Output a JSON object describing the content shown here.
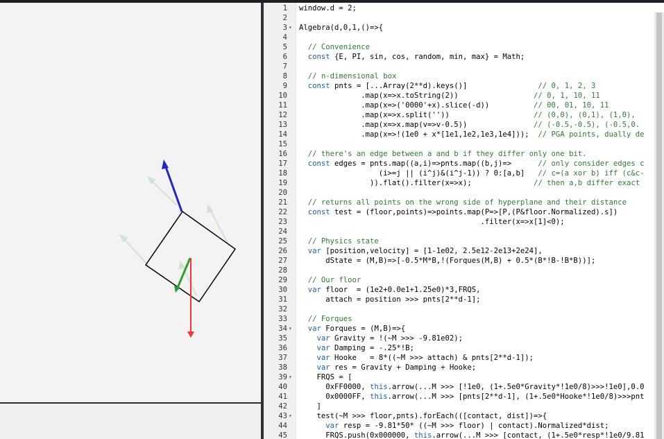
{
  "editor": {
    "lines": [
      {
        "n": "1",
        "fold": "",
        "code": "window.d = 2;"
      },
      {
        "n": "2",
        "fold": "",
        "code": ""
      },
      {
        "n": "3",
        "fold": "▾",
        "code": "Algebra(d,0,1,()=>{"
      },
      {
        "n": "4",
        "fold": "",
        "code": ""
      },
      {
        "n": "5",
        "fold": "",
        "code": "  // Convenience"
      },
      {
        "n": "6",
        "fold": "",
        "code": "  const {E, PI, sin, cos, random, min, max} = Math;"
      },
      {
        "n": "7",
        "fold": "",
        "code": ""
      },
      {
        "n": "8",
        "fold": "",
        "code": "  // n-dimensional box"
      },
      {
        "n": "9",
        "fold": "",
        "code": "  const pnts = [...Array(2**d).keys()]                // 0, 1, 2, 3"
      },
      {
        "n": "10",
        "fold": "",
        "code": "              .map(x=>x.toString(2))                 // 0, 1, 10, 11"
      },
      {
        "n": "11",
        "fold": "",
        "code": "              .map(x=>('0000'+x).slice(-d))          // 00, 01, 10, 11"
      },
      {
        "n": "12",
        "fold": "",
        "code": "              .map(x=>x.split(''))                   // (0,0), (0,1), (1,0),"
      },
      {
        "n": "13",
        "fold": "",
        "code": "              .map(x=>x.map(v=>v-0.5))               // (-0.5,-0.5), (-0.5,0."
      },
      {
        "n": "14",
        "fold": "",
        "code": "              .map(x=>!(1e0 + x*[1e1,1e2,1e3,1e4]));  // PGA points, dually de"
      },
      {
        "n": "15",
        "fold": "",
        "code": ""
      },
      {
        "n": "16",
        "fold": "",
        "code": "  // there's an edge between a and b if they differ only one bit."
      },
      {
        "n": "17",
        "fold": "",
        "code": "  const edges = pnts.map((a,i)=>pnts.map((b,j)=>      // only consider edges c"
      },
      {
        "n": "18",
        "fold": "",
        "code": "                  (i>=j || (i^j)&(i^j-1)) ? 0:[a,b]   // c=(a xor b) iff (c&c-"
      },
      {
        "n": "19",
        "fold": "",
        "code": "                )).flat().filter(x=>x);              // then a,b differ exact"
      },
      {
        "n": "20",
        "fold": "",
        "code": ""
      },
      {
        "n": "21",
        "fold": "",
        "code": "  // returns all points on the wrong side of hyperplane and their distance"
      },
      {
        "n": "22",
        "fold": "",
        "code": "  const test = (floor,points)=>points.map(P=>[P,(P&floor.Normalized).s])"
      },
      {
        "n": "23",
        "fold": "",
        "code": "                                         .filter(x=>x[1]<0);"
      },
      {
        "n": "24",
        "fold": "",
        "code": ""
      },
      {
        "n": "25",
        "fold": "",
        "code": "  // Physics state"
      },
      {
        "n": "26",
        "fold": "",
        "code": "  var [position,velocity] = [1-1e02, 2.5e12-2e13+2e24],"
      },
      {
        "n": "27",
        "fold": "",
        "code": "      dState = (M,B)=>[-0.5*M*B,!(Forques(M,B) + 0.5*(B*!B-!B*B))];"
      },
      {
        "n": "28",
        "fold": "",
        "code": ""
      },
      {
        "n": "29",
        "fold": "",
        "code": "  // Our floor"
      },
      {
        "n": "30",
        "fold": "",
        "code": "  var floor  = (1e2+0.0e1+1.25e0)*3,FRQS,"
      },
      {
        "n": "31",
        "fold": "",
        "code": "      attach = position >>> pnts[2**d-1];"
      },
      {
        "n": "32",
        "fold": "",
        "code": ""
      },
      {
        "n": "33",
        "fold": "",
        "code": "  // Forques"
      },
      {
        "n": "34",
        "fold": "▾",
        "code": "  var Forques = (M,B)=>{"
      },
      {
        "n": "35",
        "fold": "",
        "code": "    var Gravity = !(~M >>> -9.81e02);"
      },
      {
        "n": "36",
        "fold": "",
        "code": "    var Damping = -.25*!B;"
      },
      {
        "n": "37",
        "fold": "",
        "code": "    var Hooke   = 8*((~M >>> attach) & pnts[2**d-1]);"
      },
      {
        "n": "38",
        "fold": "",
        "code": "    var res = Gravity + Damping + Hooke;"
      },
      {
        "n": "39",
        "fold": "▾",
        "code": "    FRQS = ["
      },
      {
        "n": "40",
        "fold": "",
        "code": "      0xFF0000, this.arrow(...M >>> [!1e0, (1+.5e0*Gravity*!1e0/8)>>>!1e0],0.0"
      },
      {
        "n": "41",
        "fold": "",
        "code": "      0x0000FF, this.arrow(...M >>> [pnts[2**d-1], (1+.5e0*Hooke*!1e0/8)>>>pnt"
      },
      {
        "n": "42",
        "fold": "",
        "code": "    ]"
      },
      {
        "n": "43",
        "fold": "▾",
        "code": "    test(~M >>> floor,pnts).forEach(([contact, dist])=>{"
      },
      {
        "n": "44",
        "fold": "",
        "code": "      var resp = -9.81*50* ((~M >>> floor) | contact).Normalized*dist;"
      },
      {
        "n": "45",
        "fold": "",
        "code": "      FRQS.push(0x000000, this.arrow(...M >>> [contact, (1+.5e0*resp*!1e0/9.81"
      }
    ]
  },
  "scene": {
    "box_color": "#000000",
    "gravity_arrow_color": "#ff3333",
    "hooke_arrow_color": "#2222cc",
    "velocity_arrow_color": "#2e9e2e",
    "ghost_arrow_color": "#cfe3cf",
    "icons": [
      "square-body",
      "gravity-arrow",
      "hooke-arrow",
      "velocity-arrow"
    ]
  }
}
